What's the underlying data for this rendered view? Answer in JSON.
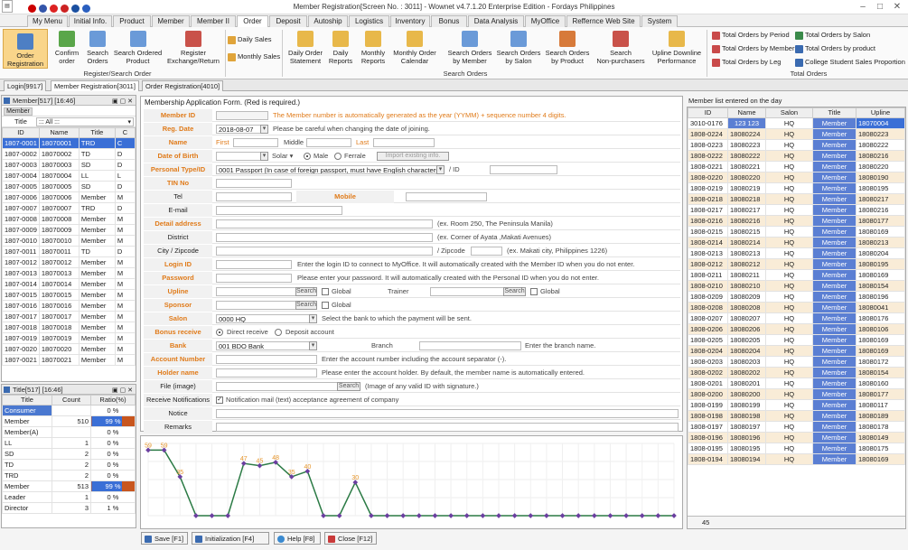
{
  "window": {
    "title": "Member Registration[Screen No. : 3011] - Wownet v4.7.1.20 Enterprise Edition - Fordays Philippines"
  },
  "menu_tabs": [
    "My Menu",
    "Initial Info.",
    "Product",
    "Member",
    "Member II",
    "Order",
    "Deposit",
    "Autoship",
    "Logistics",
    "Inventory",
    "Bonus",
    "Data Analysis",
    "MyOffice",
    "Reffernce Web Site",
    "System"
  ],
  "ribbon": {
    "register": {
      "order_registration": "Order\nRegistration",
      "confirm_order": "Confirm\norder",
      "search_orders": "Search\nOrders",
      "search_ordered_product": "Search Ordered\nProduct",
      "register_exchange": "Register\nExchange/Return",
      "group": "Register/Search Order"
    },
    "daily_sales": "Daily Sales",
    "monthly_sales": "Monthly Sales",
    "search": {
      "daily_order_statement": "Daily Order\nStatement",
      "daily_reports": "Daily\nReports",
      "monthly_reports": "Monthly\nReports",
      "monthly_order_calendar": "Monthly Order\nCalendar",
      "search_orders_by_member": "Search Orders\nby Member",
      "search_orders_by_salon": "Search Orders\nby Salon",
      "search_orders_by_product": "Search Orders\nby Product",
      "search_non_purchasers": "Search\nNon-purchasers",
      "upline_downline": "Upline Downline\nPerformance",
      "group": "Search Orders"
    },
    "total": {
      "by_period": "Total Orders by Period",
      "by_member": "Total Orders by Member",
      "by_leg": "Total Orders by Leg",
      "by_salon": "Total Orders by Salon",
      "by_product": "Total Orders by product",
      "college": "College Student Sales Proportion",
      "group": "Total Orders"
    }
  },
  "doc_tabs": [
    "Login[9917]",
    "Member Registration[3011]",
    "Order Registration[4010]"
  ],
  "member_panel": {
    "title": "Member[517] [16:46]",
    "filter_label": "Member",
    "title_label": "Title",
    "title_value": "::: All :::",
    "columns": [
      "ID",
      "Name",
      "Title",
      "C"
    ],
    "rows": [
      [
        "1807-0001",
        "18070001",
        "TRD",
        "C"
      ],
      [
        "1807-0002",
        "18070002",
        "TD",
        "D"
      ],
      [
        "1807-0003",
        "18070003",
        "SD",
        "D"
      ],
      [
        "1807-0004",
        "18070004",
        "LL",
        "L"
      ],
      [
        "1807-0005",
        "18070005",
        "SD",
        "D"
      ],
      [
        "1807-0006",
        "18070006",
        "Member",
        "M"
      ],
      [
        "1807-0007",
        "18070007",
        "TRD",
        "D"
      ],
      [
        "1807-0008",
        "18070008",
        "Member",
        "M"
      ],
      [
        "1807-0009",
        "18070009",
        "Member",
        "M"
      ],
      [
        "1807-0010",
        "18070010",
        "Member",
        "M"
      ],
      [
        "1807-0011",
        "18070011",
        "TD",
        "D"
      ],
      [
        "1807-0012",
        "18070012",
        "Member",
        "M"
      ],
      [
        "1807-0013",
        "18070013",
        "Member",
        "M"
      ],
      [
        "1807-0014",
        "18070014",
        "Member",
        "M"
      ],
      [
        "1807-0015",
        "18070015",
        "Member",
        "M"
      ],
      [
        "1807-0016",
        "18070016",
        "Member",
        "M"
      ],
      [
        "1807-0017",
        "18070017",
        "Member",
        "M"
      ],
      [
        "1807-0018",
        "18070018",
        "Member",
        "M"
      ],
      [
        "1807-0019",
        "18070019",
        "Member",
        "M"
      ],
      [
        "1807-0020",
        "18070020",
        "Member",
        "M"
      ],
      [
        "1807-0021",
        "18070021",
        "Member",
        "M"
      ]
    ]
  },
  "title_panel": {
    "title": "Title[517] [16:46]",
    "columns": [
      "Title",
      "Count",
      "Ratio(%)"
    ],
    "rows": [
      [
        "Consumer",
        "",
        "0 %"
      ],
      [
        "Member",
        "510",
        "99 %"
      ],
      [
        "Member(A)",
        "",
        "0 %"
      ],
      [
        "LL",
        "1",
        "0 %"
      ],
      [
        "SD",
        "2",
        "0 %"
      ],
      [
        "TD",
        "2",
        "0 %"
      ],
      [
        "TRD",
        "2",
        "0 %"
      ],
      [
        "Member",
        "513",
        "99 %"
      ],
      [
        "Leader",
        "1",
        "0 %"
      ],
      [
        "Director",
        "3",
        "1 %"
      ]
    ]
  },
  "form": {
    "header": "Membership Application Form. (Red is required.)",
    "member_id": {
      "label": "Member ID",
      "hint": "The Member number is automatically generated as the year (YYMM) + sequence number 4 digits."
    },
    "reg_date": {
      "label": "Reg. Date",
      "value": "2018-08-07",
      "hint": "Please be careful when changing the date of joining."
    },
    "name": {
      "label": "Name",
      "first": "First",
      "middle": "Middle",
      "last": "Last"
    },
    "dob": {
      "label": "Date of Birth",
      "calendar": "Solar",
      "male": "Male",
      "female": "Ferrale",
      "import": "Import existing info."
    },
    "personal": {
      "label": "Personal Type/ID",
      "value": "0001 Passport (In case of foreign passport, must have English characters)",
      "sep": "/ ID"
    },
    "tin": {
      "label": "TIN No"
    },
    "tel": {
      "label": "Tel",
      "mobile": "Mobile"
    },
    "email": {
      "label": "E-mail"
    },
    "detail_address": {
      "label": "Detail address",
      "hint": "(ex. Room 250, The Peninsula Manila)"
    },
    "district": {
      "label": "District",
      "hint": "(ex. Corner of Ayata ,Makati Avenues)"
    },
    "city": {
      "label": "City / Zipcode",
      "zip": "/ Zipcode",
      "hint": "(ex. Makati city, Philippines 1226)"
    },
    "login_id": {
      "label": "Login ID",
      "hint": "Enter the login ID to connect to MyOffice. It will automatically created with the Member ID when you do not enter."
    },
    "password": {
      "label": "Password",
      "hint": "Please enter your password. It will automatically created with the Personal ID when you do not enter."
    },
    "upline": {
      "label": "Upline",
      "search": "Search",
      "global": "Global",
      "trainer": "Trainer",
      "search2": "Search",
      "global2": "Global"
    },
    "sponsor": {
      "label": "Sponsor",
      "search": "Search",
      "global": "Global"
    },
    "salon": {
      "label": "Salon",
      "value": "0000 HQ",
      "hint": "Select the bank to which the payment will be sent."
    },
    "bonus": {
      "label": "Bonus receive",
      "direct": "Direct receive",
      "deposit": "Deposit account"
    },
    "bank": {
      "label": "Bank",
      "value": "001 BDO Bank",
      "branch": "Branch",
      "hint": "Enter the branch name."
    },
    "account_number": {
      "label": "Account Number",
      "hint": "Enter the account number including the account separator (-)."
    },
    "holder_name": {
      "label": "Holder name",
      "hint": "Please enter the account holder. By default, the member name is automatically entered."
    },
    "file": {
      "label": "File (image)",
      "search": "Search",
      "hint": "(Image of any valid ID with signature.)"
    },
    "receive": {
      "label": "Receive Notifications",
      "value": "Notification mail (text) acceptance agreement of company"
    },
    "notice": {
      "label": "Notice"
    },
    "remarks": {
      "label": "Remarks"
    }
  },
  "chart_data": {
    "type": "line",
    "values": [
      59,
      59,
      35,
      0,
      0,
      0,
      47,
      45,
      48,
      35,
      40,
      0,
      0,
      30,
      0,
      0,
      0,
      0,
      0,
      0,
      0,
      0,
      0,
      0,
      0,
      0,
      0,
      0,
      0,
      0,
      0,
      0,
      0,
      0
    ],
    "labels": [
      "59",
      "59",
      "35",
      "",
      "",
      "",
      "47",
      "45",
      "48",
      "35",
      "40",
      "",
      "",
      "30"
    ],
    "ylim": [
      0,
      65
    ],
    "colors": {
      "line": "#2a7a44",
      "marker": "#6b3fa0",
      "label": "#e6952b"
    }
  },
  "bottom_buttons": {
    "save": "Save [F1]",
    "init": "Initialization [F4]",
    "help": "Help [F8]",
    "close": "Close [F12]"
  },
  "right_panel": {
    "title": "Member list entered on the day",
    "columns": [
      "ID",
      "Name",
      "Salon",
      "Title",
      "Upline"
    ],
    "rows": [
      [
        "3010-0176",
        "123 123",
        "HQ",
        "Member",
        "18070004"
      ],
      [
        "1808-0224",
        "18080224",
        "HQ",
        "Member",
        "18080223"
      ],
      [
        "1808-0223",
        "18080223",
        "HQ",
        "Member",
        "18080222"
      ],
      [
        "1808-0222",
        "18080222",
        "HQ",
        "Member",
        "18080216"
      ],
      [
        "1808-0221",
        "18080221",
        "HQ",
        "Member",
        "18080220"
      ],
      [
        "1808-0220",
        "18080220",
        "HQ",
        "Member",
        "18080190"
      ],
      [
        "1808-0219",
        "18080219",
        "HQ",
        "Member",
        "18080195"
      ],
      [
        "1808-0218",
        "18080218",
        "HQ",
        "Member",
        "18080217"
      ],
      [
        "1808-0217",
        "18080217",
        "HQ",
        "Member",
        "18080216"
      ],
      [
        "1808-0216",
        "18080216",
        "HQ",
        "Member",
        "18080177"
      ],
      [
        "1808-0215",
        "18080215",
        "HQ",
        "Member",
        "18080169"
      ],
      [
        "1808-0214",
        "18080214",
        "HQ",
        "Member",
        "18080213"
      ],
      [
        "1808-0213",
        "18080213",
        "HQ",
        "Member",
        "18080204"
      ],
      [
        "1808-0212",
        "18080212",
        "HQ",
        "Member",
        "18080195"
      ],
      [
        "1808-0211",
        "18080211",
        "HQ",
        "Member",
        "18080169"
      ],
      [
        "1808-0210",
        "18080210",
        "HQ",
        "Member",
        "18080154"
      ],
      [
        "1808-0209",
        "18080209",
        "HQ",
        "Member",
        "18080196"
      ],
      [
        "1808-0208",
        "18080208",
        "HQ",
        "Member",
        "18080041"
      ],
      [
        "1808-0207",
        "18080207",
        "HQ",
        "Member",
        "18080176"
      ],
      [
        "1808-0206",
        "18080206",
        "HQ",
        "Member",
        "18080106"
      ],
      [
        "1808-0205",
        "18080205",
        "HQ",
        "Member",
        "18080169"
      ],
      [
        "1808-0204",
        "18080204",
        "HQ",
        "Member",
        "18080169"
      ],
      [
        "1808-0203",
        "18080203",
        "HQ",
        "Member",
        "18080172"
      ],
      [
        "1808-0202",
        "18080202",
        "HQ",
        "Member",
        "18080154"
      ],
      [
        "1808-0201",
        "18080201",
        "HQ",
        "Member",
        "18080160"
      ],
      [
        "1808-0200",
        "18080200",
        "HQ",
        "Member",
        "18080177"
      ],
      [
        "1808-0199",
        "18080199",
        "HQ",
        "Member",
        "18080117"
      ],
      [
        "1808-0198",
        "18080198",
        "HQ",
        "Member",
        "18080189"
      ],
      [
        "1808-0197",
        "18080197",
        "HQ",
        "Member",
        "18080178"
      ],
      [
        "1808-0196",
        "18080196",
        "HQ",
        "Member",
        "18080149"
      ],
      [
        "1808-0195",
        "18080195",
        "HQ",
        "Member",
        "18080175"
      ],
      [
        "1808-0194",
        "18080194",
        "HQ",
        "Member",
        "18080169"
      ]
    ],
    "count": "45"
  }
}
